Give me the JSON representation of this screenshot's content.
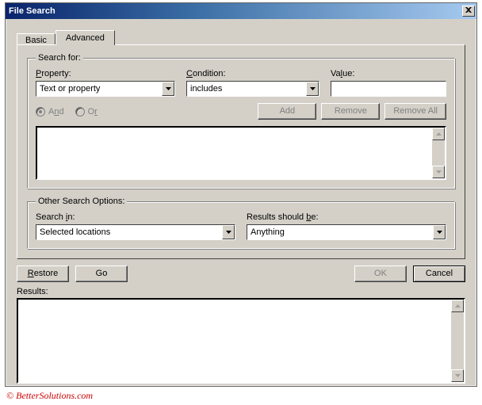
{
  "window": {
    "title": "File Search"
  },
  "tabs": {
    "basic": "Basic",
    "advanced": "Advanced"
  },
  "searchfor": {
    "legend": "Search for:",
    "property_label": "Property:",
    "property_value": "Text or property",
    "condition_label": "Condition:",
    "condition_value": "includes",
    "value_label": "Value:",
    "value_value": "",
    "radio_and": "And",
    "radio_or": "Or",
    "btn_add": "Add",
    "btn_remove": "Remove",
    "btn_removeall": "Remove All"
  },
  "otheroptions": {
    "legend": "Other Search Options:",
    "searchin_label": "Search in:",
    "searchin_value": "Selected locations",
    "results_label": "Results should be:",
    "results_value": "Anything"
  },
  "footer": {
    "restore": "Restore",
    "go": "Go",
    "ok": "OK",
    "cancel": "Cancel"
  },
  "results": {
    "label": "Results:"
  },
  "attribution": "© BetterSolutions.com"
}
